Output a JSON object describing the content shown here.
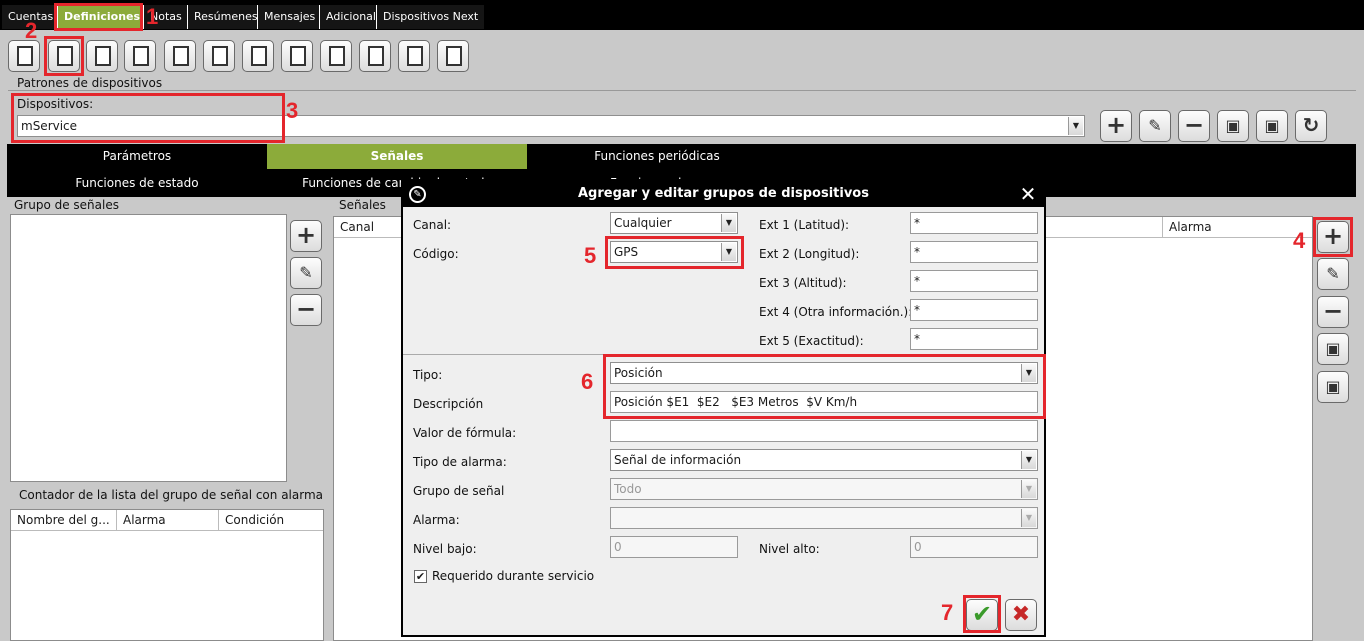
{
  "tabs": [
    "Cuentas",
    "Definiciones",
    "Notas",
    "Resúmenes",
    "Mensajes",
    "Adicional",
    "Dispositivos Next"
  ],
  "patrones_title": "Patrones de dispositivos",
  "dispositivos_label": "Dispositivos:",
  "dispositivos_value": "mService",
  "signal_tabs_row1": [
    "Parámetros",
    "Señales",
    "Funciones periódicas"
  ],
  "signal_tabs_row2": [
    "Funciones de estado",
    "Funciones de cambio de estado",
    "Funciones de ..."
  ],
  "grupo_senales_title": "Grupo de señales",
  "senales_title": "Señales",
  "senales_columns": [
    "Canal",
    "Alarma"
  ],
  "contador_title": "Contador de la lista del grupo de señal con alarma",
  "contador_columns": [
    "Nombre del g...",
    "Alarma",
    "Condición"
  ],
  "annotations": [
    "1",
    "2",
    "3",
    "4",
    "5",
    "6",
    "7"
  ],
  "dialog": {
    "title": "Agregar y editar grupos de dispositivos",
    "canal_label": "Canal:",
    "canal_value": "Cualquier",
    "codigo_label": "Código:",
    "codigo_value": "GPS",
    "ext1_label": "Ext 1 (Latitud):",
    "ext2_label": "Ext 2 (Longitud):",
    "ext3_label": "Ext 3 (Altitud):",
    "ext4_label": "Ext 4 (Otra información.):",
    "ext5_label": "Ext 5 (Exactitud):",
    "ext_value": "*",
    "tipo_label": "Tipo:",
    "tipo_value": "Posición",
    "descripcion_label": "Descripción",
    "descripcion_value": "Posición $E1  $E2   $E3 Metros  $V Km/h",
    "valor_label": "Valor de fórmula:",
    "valor_value": "",
    "tipo_alarma_label": "Tipo de alarma:",
    "tipo_alarma_value": "Señal de información",
    "grupo_label": "Grupo de señal",
    "grupo_value": "Todo",
    "alarma_label": "Alarma:",
    "alarma_value": "",
    "nivel_bajo_label": "Nivel bajo:",
    "nivel_bajo_value": "0",
    "nivel_alto_label": "Nivel alto:",
    "nivel_alto_value": "0",
    "requerido_label": "Requerido durante servicio",
    "requerido_checked": true
  },
  "colors": {
    "accent_green": "#8cab3a",
    "annotation_red": "#e4262c"
  }
}
